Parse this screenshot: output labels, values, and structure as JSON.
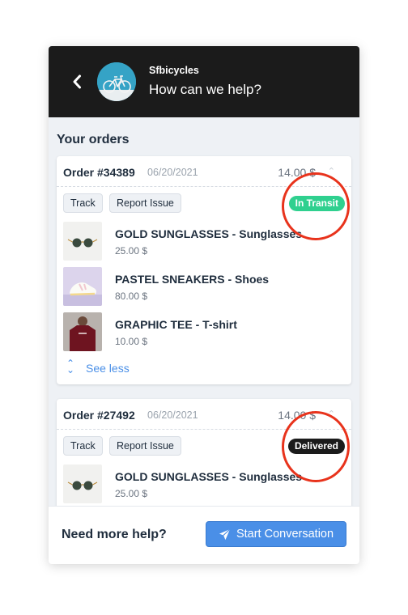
{
  "header": {
    "brand": "Sfbicycles",
    "greeting": "How can we help?"
  },
  "orders_section": {
    "title": "Your orders"
  },
  "orders": [
    {
      "id": "Order #34389",
      "date": "06/20/2021",
      "total": "14.00 $",
      "track_label": "Track",
      "report_label": "Report Issue",
      "status": "In Transit",
      "status_color": "#2fd08f",
      "items": [
        {
          "name": "GOLD SUNGLASSES - Sunglasses",
          "price": "25.00 $",
          "icon": "sunglasses-image"
        },
        {
          "name": "PASTEL SNEAKERS - Shoes",
          "price": "80.00 $",
          "icon": "sneakers-image"
        },
        {
          "name": "GRAPHIC TEE - T-shirt",
          "price": "10.00 $",
          "icon": "tshirt-image"
        }
      ],
      "see_less_label": "See less"
    },
    {
      "id": "Order #27492",
      "date": "06/20/2021",
      "total": "14.00 $",
      "track_label": "Track",
      "report_label": "Report Issue",
      "status": "Delivered",
      "status_color": "#1b1b1b",
      "items": [
        {
          "name": "GOLD SUNGLASSES - Sunglasses",
          "price": "25.00 $",
          "icon": "sunglasses-image"
        }
      ]
    }
  ],
  "footer": {
    "help_text": "Need more help?",
    "cta_label": "Start Conversation"
  },
  "colors": {
    "header_bg": "#1b1b1b",
    "accent": "#4a8fe7",
    "annotation": "#e8331c"
  }
}
